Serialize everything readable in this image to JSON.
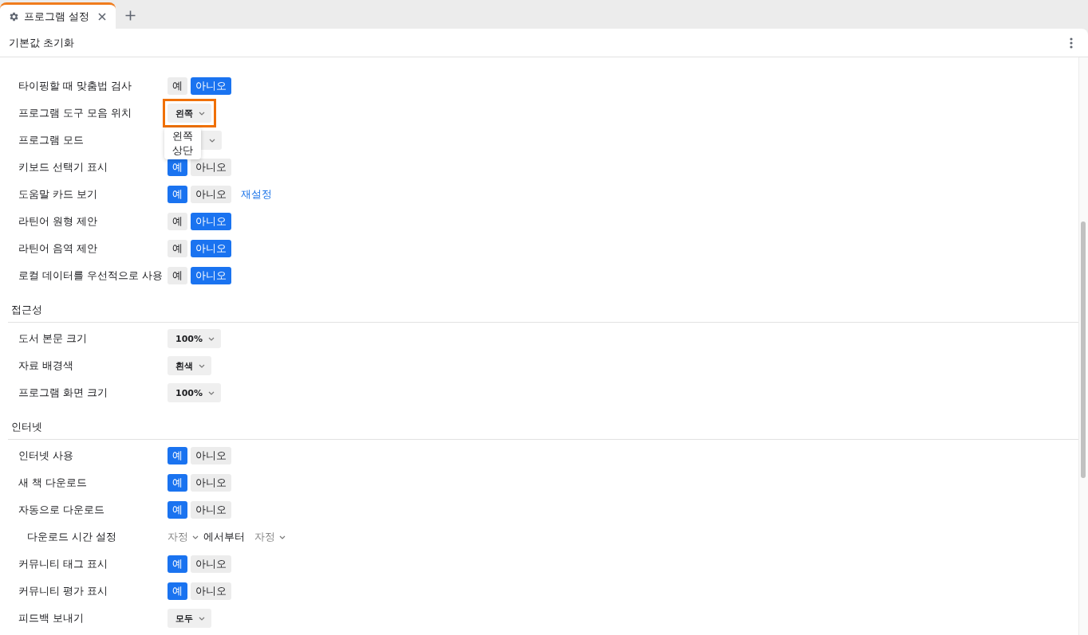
{
  "tabs": [
    {
      "label": "프로그램 설정",
      "selected": true,
      "closable": true
    }
  ],
  "toolbar": {
    "title": "기본값 초기화"
  },
  "sections": [
    {
      "rows": [
        {
          "label": "타이핑할 때 맞춤법 검사",
          "kind": "toggle",
          "options": [
            {
              "label": "예",
              "selected": false
            },
            {
              "label": "아니오",
              "selected": true
            }
          ]
        },
        {
          "label": "프로그램 도구 모음 위치",
          "kind": "select",
          "value": "왼쪽",
          "focused": true,
          "menu": [
            {
              "label": "왼쪽"
            },
            {
              "label": "상단"
            }
          ]
        },
        {
          "label": "프로그램 모드",
          "kind": "select"
        },
        {
          "label": "키보드 선택기 표시",
          "kind": "toggle",
          "options": [
            {
              "label": "예",
              "selected": true
            },
            {
              "label": "아니오",
              "selected": false
            }
          ]
        },
        {
          "label": "도움말 카드 보기",
          "kind": "toggle",
          "options": [
            {
              "label": "예",
              "selected": true
            },
            {
              "label": "아니오",
              "selected": false
            }
          ],
          "link": "재설정"
        },
        {
          "label": "라틴어 원형 제안",
          "kind": "toggle",
          "options": [
            {
              "label": "예",
              "selected": false
            },
            {
              "label": "아니오",
              "selected": true
            }
          ]
        },
        {
          "label": "라틴어 음역 제안",
          "kind": "toggle",
          "options": [
            {
              "label": "예",
              "selected": false
            },
            {
              "label": "아니오",
              "selected": true
            }
          ]
        },
        {
          "label": "로컬 데이터를 우선적으로 사용",
          "kind": "toggle",
          "options": [
            {
              "label": "예",
              "selected": false
            },
            {
              "label": "아니오",
              "selected": true
            }
          ]
        }
      ]
    },
    {
      "title": "접근성",
      "rows": [
        {
          "label": "도서 본문 크기",
          "kind": "select",
          "value": "100%"
        },
        {
          "label": "자료 배경색",
          "kind": "select",
          "value": "흰색"
        },
        {
          "label": "프로그램 화면 크기",
          "kind": "select",
          "value": "100%"
        }
      ]
    },
    {
      "title": "인터넷",
      "rows": [
        {
          "label": "인터넷 사용",
          "kind": "toggle",
          "options": [
            {
              "label": "예",
              "selected": true
            },
            {
              "label": "아니오",
              "selected": false
            }
          ]
        },
        {
          "label": "새 책 다운로드",
          "kind": "toggle",
          "options": [
            {
              "label": "예",
              "selected": true
            },
            {
              "label": "아니오",
              "selected": false
            }
          ]
        },
        {
          "label": "자동으로 다운로드",
          "kind": "toggle",
          "options": [
            {
              "label": "예",
              "selected": true
            },
            {
              "label": "아니오",
              "selected": false
            }
          ],
          "children": [
            {
              "label": "다운로드 시간 설정",
              "kind": "range",
              "from": "자정",
              "connector": "에서부터",
              "to": "자정"
            }
          ]
        },
        {
          "label": "커뮤니티 태그 표시",
          "kind": "toggle",
          "options": [
            {
              "label": "예",
              "selected": true
            },
            {
              "label": "아니오",
              "selected": false
            }
          ]
        },
        {
          "label": "커뮤니티 평가 표시",
          "kind": "toggle",
          "options": [
            {
              "label": "예",
              "selected": true
            },
            {
              "label": "아니오",
              "selected": false
            }
          ]
        },
        {
          "label": "피드백 보내기",
          "kind": "select",
          "value": "모두"
        }
      ]
    }
  ]
}
